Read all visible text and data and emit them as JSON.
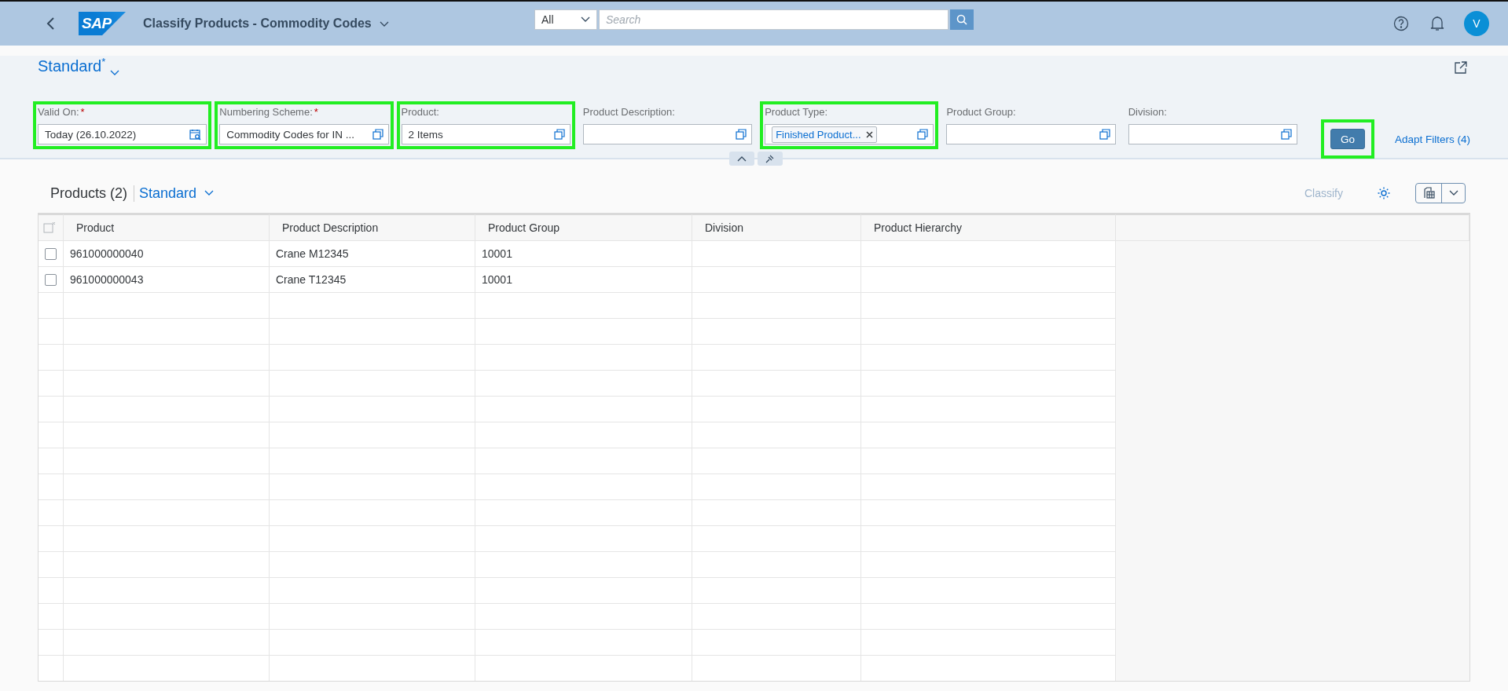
{
  "shell": {
    "title": "Classify Products - Commodity Codes",
    "search_scope": "All",
    "search_placeholder": "Search",
    "avatar": "V",
    "logo_text": "SAP"
  },
  "variant": {
    "name": "Standard",
    "modified_mark": "*"
  },
  "filters": [
    {
      "label": "Valid On:",
      "required_mark": "*",
      "value": "Today (26.10.2022)",
      "kind": "date",
      "highlighted": true
    },
    {
      "label": "Numbering Scheme:",
      "required_mark": "*",
      "value": "Commodity Codes for IN  ...",
      "kind": "valuehelp",
      "highlighted": true
    },
    {
      "label": "Product:",
      "value": "2 Items",
      "kind": "valuehelp",
      "highlighted": true
    },
    {
      "label": "Product Description:",
      "kind": "valuehelp",
      "highlighted": false
    },
    {
      "label": "Product Type:",
      "token": "Finished Product...",
      "kind": "token",
      "highlighted": true
    },
    {
      "label": "Product Group:",
      "kind": "valuehelp",
      "highlighted": false
    },
    {
      "label": "Division:",
      "kind": "valuehelp",
      "highlighted": false
    }
  ],
  "go_button": {
    "label": "Go",
    "highlighted": true
  },
  "adapt_filters": "Adapt Filters (4)",
  "table": {
    "title": "Products (2)",
    "variant": "Standard",
    "classify_button": {
      "label": "Classify",
      "disabled": true
    },
    "columns": [
      "Product",
      "Product Description",
      "Product Group",
      "Division",
      "Product Hierarchy"
    ],
    "rows": [
      {
        "selected": false,
        "cells": [
          "961000000040",
          "Crane M12345",
          "10001",
          "",
          ""
        ]
      },
      {
        "selected": false,
        "cells": [
          "961000000043",
          "Crane T12345",
          "10001",
          "",
          ""
        ]
      }
    ]
  }
}
